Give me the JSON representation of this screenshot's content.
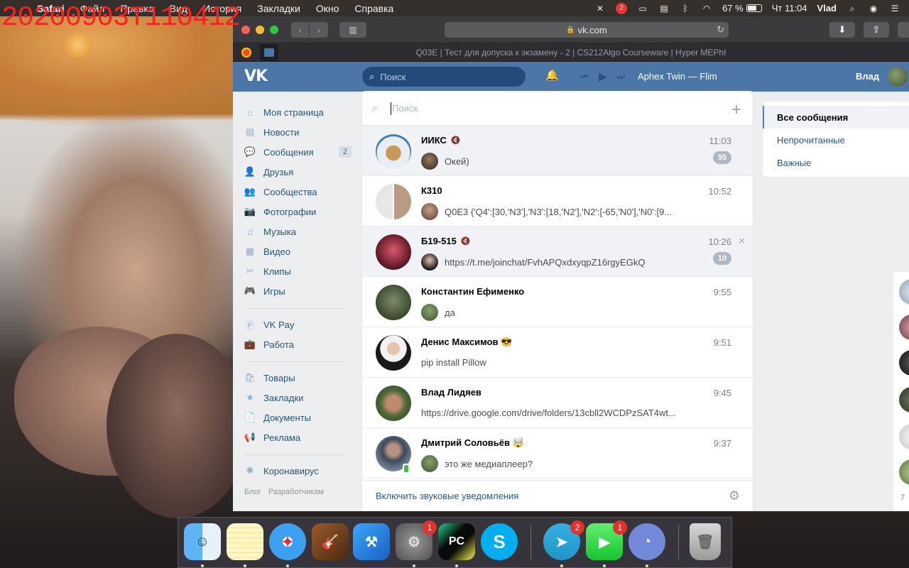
{
  "overlay": {
    "timestamp": "20200903T110412"
  },
  "menubar": {
    "app": "Safari",
    "menus": [
      "Safari",
      "Файл",
      "Правка",
      "Вид",
      "История",
      "Закладки",
      "Окно",
      "Справка"
    ],
    "notification_badge": "2",
    "battery": "67 %",
    "clock": "Чт 11:04",
    "user": "Vlad"
  },
  "browser": {
    "url": "vk.com",
    "tab_title": "Q03E | Тест для допуска к экзамену - 2 | CS212Algo Courseware | Hyper MEPhI"
  },
  "vk": {
    "header": {
      "search_placeholder": "Поиск",
      "track": "Aphex Twin — Flim",
      "user_name": "Влад"
    },
    "nav": [
      {
        "label": "Моя страница",
        "icon": "home-icon"
      },
      {
        "label": "Новости",
        "icon": "news-icon"
      },
      {
        "label": "Сообщения",
        "icon": "messages-icon",
        "count": "2"
      },
      {
        "label": "Друзья",
        "icon": "friends-icon"
      },
      {
        "label": "Сообщества",
        "icon": "communities-icon"
      },
      {
        "label": "Фотографии",
        "icon": "camera-icon"
      },
      {
        "label": "Музыка",
        "icon": "music-icon"
      },
      {
        "label": "Видео",
        "icon": "video-icon"
      },
      {
        "label": "Клипы",
        "icon": "clips-icon"
      },
      {
        "label": "Игры",
        "icon": "gamepad-icon"
      },
      {
        "label": "VK Pay",
        "icon": "vkpay-icon"
      },
      {
        "label": "Работа",
        "icon": "briefcase-icon"
      },
      {
        "label": "Товары",
        "icon": "shopping-bag-icon"
      },
      {
        "label": "Закладки",
        "icon": "star-icon"
      },
      {
        "label": "Документы",
        "icon": "document-icon"
      },
      {
        "label": "Реклама",
        "icon": "megaphone-icon"
      },
      {
        "label": "Коронавирус",
        "icon": "virus-icon"
      }
    ],
    "footer_links": [
      "Блог",
      "Разработчикам"
    ],
    "im": {
      "search_placeholder": "Поиск",
      "dialogs": [
        {
          "name": "ИИКС",
          "muted": true,
          "time": "11:03",
          "preview": "Окей)",
          "counter": "55",
          "unread": true
        },
        {
          "name": "К310",
          "muted": false,
          "time": "10:52",
          "preview": "Q0E3 {'Q4':[30,'N3'],'N3':[18,'N2'],'N2':[-65,'N0'],'N0':[9...",
          "unread": false
        },
        {
          "name": "Б19-515",
          "muted": true,
          "time": "10:26",
          "preview": "https://t.me/joinchat/FvhAPQxdxyqpZ16rgyEGkQ",
          "counter": "10",
          "unread": true
        },
        {
          "name": "Константин Ефименко",
          "muted": false,
          "time": "9:55",
          "preview": "да",
          "unread": false
        },
        {
          "name": "Денис Максимов 😎",
          "muted": false,
          "time": "9:51",
          "preview": "pip install Pillow",
          "unread": false
        },
        {
          "name": "Влад Лидяев",
          "muted": false,
          "time": "9:45",
          "preview": "https://drive.google.com/drive/folders/13cbll2WCDPzSAT4wt...",
          "unread": false
        },
        {
          "name": "Дмитрий Соловьёв 🤯",
          "muted": false,
          "time": "9:37",
          "preview": "это же медиаплеер?",
          "unread": false
        }
      ],
      "footer": "Включить звуковые уведомления"
    },
    "filters": [
      "Все сообщения",
      "Непрочитанные",
      "Важные"
    ],
    "side_counter": "7"
  },
  "dock": {
    "apps": [
      {
        "name": "Finder",
        "badge": ""
      },
      {
        "name": "Notes",
        "badge": ""
      },
      {
        "name": "Safari",
        "badge": ""
      },
      {
        "name": "GarageBand",
        "badge": ""
      },
      {
        "name": "Xcode",
        "badge": ""
      },
      {
        "name": "System Preferences",
        "badge": "1"
      },
      {
        "name": "PyCharm",
        "badge": ""
      },
      {
        "name": "Skype",
        "badge": ""
      },
      {
        "name": "Telegram",
        "badge": "2"
      },
      {
        "name": "FaceTime",
        "badge": "1"
      },
      {
        "name": "Discord",
        "badge": ""
      },
      {
        "name": "Trash",
        "badge": ""
      }
    ]
  },
  "colors": {
    "vk_blue": "#4a76a8",
    "link": "#2a5885",
    "badge": "#aeb7c2",
    "timestamp_red": "#ff1e1e"
  }
}
